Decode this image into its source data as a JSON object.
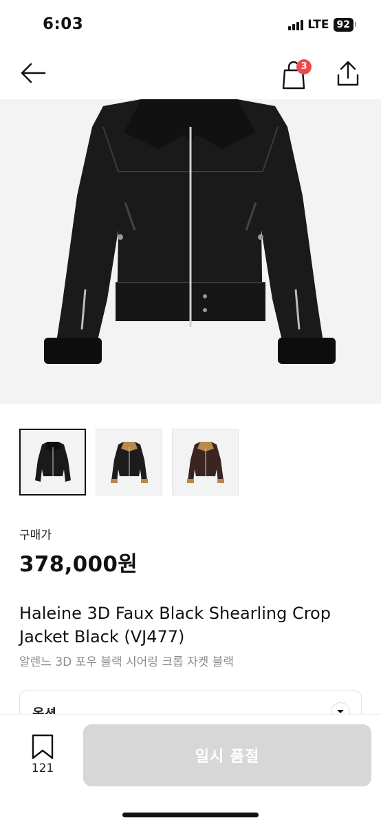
{
  "status_bar": {
    "time": "6:03",
    "network": "LTE",
    "battery": "92"
  },
  "nav": {
    "back_icon": "arrow-left-icon",
    "cart_icon": "shopping-bag-icon",
    "cart_count": "3",
    "share_icon": "share-icon"
  },
  "product": {
    "price_label": "구매가",
    "price": "378,000원",
    "title": "Haleine 3D Faux Black Shearling Crop Jacket Black (VJ477)",
    "subtitle": "알렌느 3D 포우 블랙 시어링 크롭 자켓 블랙",
    "thumbnails": [
      {
        "variant": "black-black",
        "selected": true
      },
      {
        "variant": "black-camel",
        "selected": false
      },
      {
        "variant": "brown-camel",
        "selected": false
      }
    ]
  },
  "option": {
    "label": "옵션"
  },
  "bottom": {
    "wish_count": "121",
    "soldout_label": "일시 품절"
  },
  "colors": {
    "badge": "#ef4a4a",
    "button_disabled": "#d7d7d7",
    "muted_text": "#8a8a8a"
  }
}
